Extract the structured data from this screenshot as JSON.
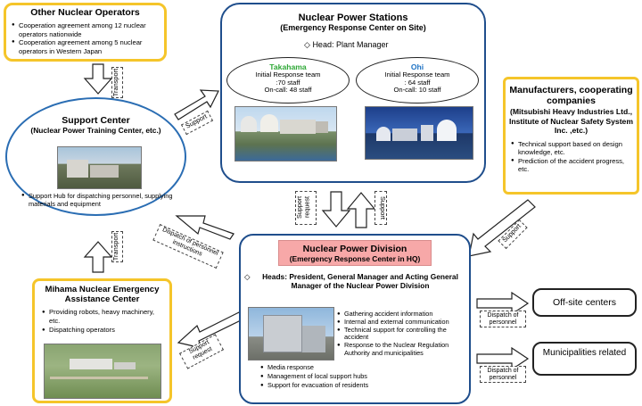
{
  "other_operators": {
    "title": "Other Nuclear Operators",
    "bullets": [
      "Cooperation agreement among 12 nuclear operators nationwide",
      "Cooperation agreement among 5 nuclear operators in Western Japan"
    ]
  },
  "stations": {
    "title": "Nuclear Power Stations",
    "subtitle": "(Emergency Response Center on Site)",
    "head": "Head: Plant Manager",
    "takahama": {
      "name": "Takahama",
      "line1": "Initial Response team",
      "line2": ":70 staff",
      "line3": "On-call: 48 staff"
    },
    "ohi": {
      "name": "Ohi",
      "line1": "Initial Response team",
      "line2": ": 64 staff",
      "line3": "On-call: 10 staff"
    }
  },
  "support_center": {
    "title": "Support Center",
    "subtitle": "(Nuclear Power Training Center, etc.)",
    "bullet": "Support Hub for dispatching  personnel, supplying materials and equipment"
  },
  "manufacturers": {
    "title": "Manufacturers, cooperating companies",
    "subtitle": "(Mitsubishi Heavy Industries Ltd., Institute of Nuclear Safety System Inc. ,etc.)",
    "bullets": [
      "Technical support based on design knowledge, etc.",
      "Prediction of the accident progress, etc."
    ]
  },
  "division": {
    "title": "Nuclear Power Division",
    "subtitle": "(Emergency Response Center in HQ)",
    "heads": "Heads: President, General Manager and Acting General Manager of the Nuclear Power Division",
    "right_bullets": [
      "Gathering accident information",
      "Internal and external communication",
      "Technical support for controlling the accident",
      "Response to the Nuclear Regulation Authority and  municipalities"
    ],
    "bottom_bullets": [
      "Media response",
      "Management of local support hubs",
      "Support for evacuation of residents"
    ]
  },
  "mihama": {
    "title": "Mihama Nuclear Emergency Assistance Center",
    "bullets": [
      "Providing robots, heavy machinery, etc.",
      "Dispatching operators"
    ]
  },
  "offsite": "Off-site centers",
  "municipalities": "Municipalities related",
  "labels": {
    "transport_top": "Transport",
    "transport_bottom": "Transport",
    "support_to_stations": "Support",
    "support_request_up": "Support request",
    "support_down": "Support",
    "support_manuf": "Support",
    "dispatch_instructions": "Dispatch of personnel instructions",
    "support_request_mihama": "Support request",
    "dispatch_offsite": "Dispatch of personnel",
    "dispatch_municipal": "Dispatch of personnel"
  },
  "colors": {
    "yellow": "#f5c52a",
    "blue": "#1f4e8c",
    "pink": "#f7a8a8",
    "green": "#2ea836",
    "ohi_blue": "#1f73c4"
  }
}
